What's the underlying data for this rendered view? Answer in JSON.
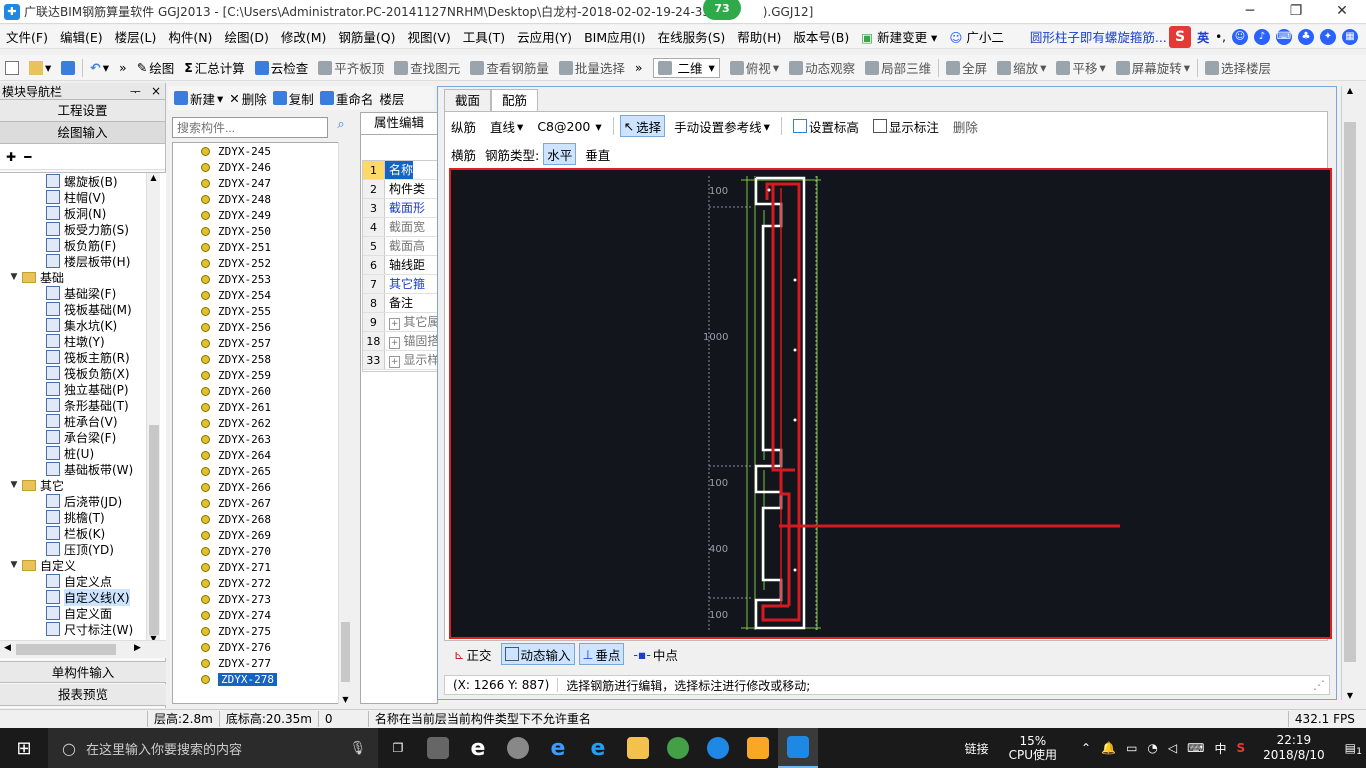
{
  "window": {
    "title": "广联达BIM钢筋算量软件 GGJ2013 - [C:\\Users\\Administrator.PC-20141127NRHM\\Desktop\\白龙村-2018-02-02-19-24-35(",
    "title_tail": ").GGJ12]",
    "badge": "73",
    "minimize": "─",
    "restore": "❐",
    "close": "✕"
  },
  "menu": [
    "文件(F)",
    "编辑(E)",
    "楼层(L)",
    "构件(N)",
    "绘图(D)",
    "修改(M)",
    "钢筋量(Q)",
    "视图(V)",
    "工具(T)",
    "云应用(Y)",
    "BIM应用(I)",
    "在线服务(S)",
    "帮助(H)",
    "版本号(B)",
    "新建变更",
    "广小二"
  ],
  "menu_extra": {
    "hint": "圆形柱子即有螺旋箍筋...",
    "ime_logo": "S",
    "ime_lang": "英"
  },
  "toolbar1": {
    "draw": "绘图",
    "sum": "汇总计算",
    "cloud_check": "云检查",
    "align_slab": "平齐板顶",
    "find_elem": "查找图元",
    "view_rebar": "查看钢筋量",
    "batch_select": "批量选择",
    "view_mode": "二维",
    "top_view": "俯视",
    "dynamic_obs": "动态观察",
    "local_3d": "局部三维",
    "fullscreen": "全屏",
    "zoom": "缩放",
    "pan": "平移",
    "rotate": "屏幕旋转",
    "select_floor": "选择楼层"
  },
  "nav": {
    "header": "模块导航栏",
    "pin": "ᅮ",
    "close": "×",
    "btn_project": "工程设置",
    "btn_draw": "绘图输入",
    "btn_single": "单构件输入",
    "btn_report": "报表预览",
    "tree": [
      {
        "label": "螺旋板(B)",
        "level": 2
      },
      {
        "label": "柱帽(V)",
        "level": 2
      },
      {
        "label": "板洞(N)",
        "level": 2
      },
      {
        "label": "板受力筋(S)",
        "level": 2
      },
      {
        "label": "板负筋(F)",
        "level": 2
      },
      {
        "label": "楼层板带(H)",
        "level": 2
      },
      {
        "label": "基础",
        "level": 1
      },
      {
        "label": "基础梁(F)",
        "level": 2
      },
      {
        "label": "筏板基础(M)",
        "level": 2
      },
      {
        "label": "集水坑(K)",
        "level": 2
      },
      {
        "label": "柱墩(Y)",
        "level": 2
      },
      {
        "label": "筏板主筋(R)",
        "level": 2
      },
      {
        "label": "筏板负筋(X)",
        "level": 2
      },
      {
        "label": "独立基础(P)",
        "level": 2
      },
      {
        "label": "条形基础(T)",
        "level": 2
      },
      {
        "label": "桩承台(V)",
        "level": 2
      },
      {
        "label": "承台梁(F)",
        "level": 2
      },
      {
        "label": "桩(U)",
        "level": 2
      },
      {
        "label": "基础板带(W)",
        "level": 2
      },
      {
        "label": "其它",
        "level": 1
      },
      {
        "label": "后浇带(JD)",
        "level": 2
      },
      {
        "label": "挑檐(T)",
        "level": 2
      },
      {
        "label": "栏板(K)",
        "level": 2
      },
      {
        "label": "压顶(YD)",
        "level": 2
      },
      {
        "label": "自定义",
        "level": 1
      },
      {
        "label": "自定义点",
        "level": 2
      },
      {
        "label": "自定义线(X)",
        "level": 2
      },
      {
        "label": "自定义面",
        "level": 2
      },
      {
        "label": "尺寸标注(W)",
        "level": 2
      }
    ]
  },
  "components": {
    "new": "新建",
    "delete": "删除",
    "copy": "复制",
    "rename": "重命名",
    "floor": "楼层",
    "search_placeholder": "搜索构件...",
    "items": [
      "ZDYX-245",
      "ZDYX-246",
      "ZDYX-247",
      "ZDYX-248",
      "ZDYX-249",
      "ZDYX-250",
      "ZDYX-251",
      "ZDYX-252",
      "ZDYX-253",
      "ZDYX-254",
      "ZDYX-255",
      "ZDYX-256",
      "ZDYX-257",
      "ZDYX-258",
      "ZDYX-259",
      "ZDYX-260",
      "ZDYX-261",
      "ZDYX-262",
      "ZDYX-263",
      "ZDYX-264",
      "ZDYX-265",
      "ZDYX-266",
      "ZDYX-267",
      "ZDYX-268",
      "ZDYX-269",
      "ZDYX-270",
      "ZDYX-271",
      "ZDYX-272",
      "ZDYX-273",
      "ZDYX-274",
      "ZDYX-275",
      "ZDYX-276",
      "ZDYX-277",
      "ZDYX-278"
    ],
    "selected": "ZDYX-278"
  },
  "properties": {
    "tab": "属性编辑",
    "rows": [
      {
        "n": "1",
        "v": "名称"
      },
      {
        "n": "2",
        "v": "构件类"
      },
      {
        "n": "3",
        "v": "截面形"
      },
      {
        "n": "4",
        "v": "截面宽"
      },
      {
        "n": "5",
        "v": "截面高"
      },
      {
        "n": "6",
        "v": "轴线距"
      },
      {
        "n": "7",
        "v": "其它箍"
      },
      {
        "n": "8",
        "v": "备注"
      },
      {
        "n": "9",
        "v": "其它属"
      },
      {
        "n": "18",
        "v": "锚固搭"
      },
      {
        "n": "33",
        "v": "显示样"
      }
    ]
  },
  "editor": {
    "tab_section": "截面",
    "tab_rebar": "配筋",
    "long_rebar": "纵筋",
    "line_type": "直线",
    "spec": "C8@200",
    "select": "选择",
    "manual_ref": "手动设置参考线",
    "set_elev": "设置标高",
    "show_dim": "显示标注",
    "delete": "删除",
    "trans_rebar": "横筋",
    "rebar_type_label": "钢筋类型:",
    "horizontal": "水平",
    "vertical": "垂直",
    "ortho": "正交",
    "dynamic_input": "动态输入",
    "perpendicular": "垂点",
    "midpoint": "中点",
    "coords": "(X: 1266 Y: 887)",
    "hint": "选择钢筋进行编辑，选择标注进行修改或移动;",
    "dims": {
      "d100_top": "100",
      "d1000": "1000",
      "d100_mid": "100",
      "d400": "400",
      "d100_bot": "100"
    }
  },
  "statusbar": {
    "floor_h": "层高:2.8m",
    "base_h": "底标高:20.35m",
    "zero": "0",
    "msg": "名称在当前层当前构件类型下不允许重名",
    "fps": "432.1 FPS"
  },
  "taskbar": {
    "search": "在这里输入你要搜索的内容",
    "link": "链接",
    "cpu_pct": "15%",
    "cpu_label": "CPU使用",
    "ime": "中",
    "time": "22:19",
    "date": "2018/8/10",
    "notif": "1"
  }
}
